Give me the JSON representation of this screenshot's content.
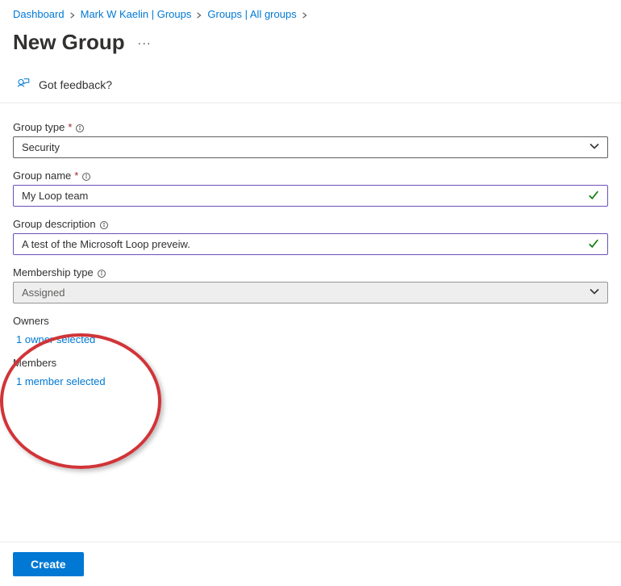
{
  "breadcrumb": {
    "items": [
      {
        "label": "Dashboard"
      },
      {
        "label": "Mark W Kaelin | Groups"
      },
      {
        "label": "Groups | All groups"
      }
    ]
  },
  "header": {
    "title": "New Group",
    "more": "···"
  },
  "feedback": {
    "text": "Got feedback?"
  },
  "form": {
    "group_type": {
      "label": "Group type",
      "required": true,
      "value": "Security"
    },
    "group_name": {
      "label": "Group name",
      "required": true,
      "value": "My Loop team"
    },
    "group_description": {
      "label": "Group description",
      "required": false,
      "value": "A test of the Microsoft Loop preveiw."
    },
    "membership_type": {
      "label": "Membership type",
      "required": false,
      "value": "Assigned"
    },
    "owners": {
      "label": "Owners",
      "selected_text": "1 owner selected"
    },
    "members": {
      "label": "Members",
      "selected_text": "1 member selected"
    }
  },
  "footer": {
    "create_button": "Create"
  }
}
